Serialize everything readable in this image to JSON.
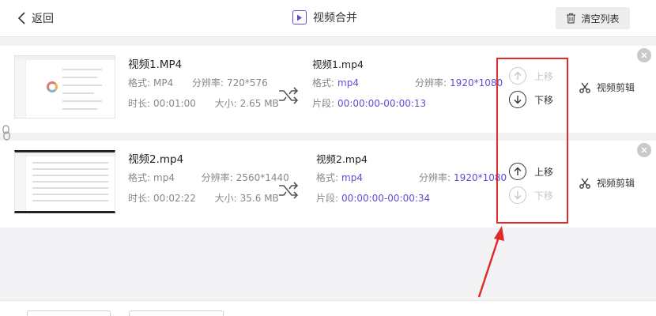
{
  "header": {
    "back_label": "返回",
    "title": "视频合并",
    "clear_label": "清空列表"
  },
  "items": [
    {
      "src_name": "视频1.MP4",
      "format_label": "格式:",
      "format": "MP4",
      "resolution_label": "分辨率:",
      "resolution": "720*576",
      "duration_label": "时长:",
      "duration": "00:01:00",
      "size_label": "大小:",
      "size": "2.65 MB",
      "dst_name": "视频1.mp4",
      "dst_format_label": "格式:",
      "dst_format": "mp4",
      "dst_resolution_label": "分辨率:",
      "dst_resolution": "1920*1080",
      "segment_label": "片段:",
      "segment": "00:00:00-00:00:13",
      "move_up": "上移",
      "move_down": "下移",
      "edit_label": "视频剪辑"
    },
    {
      "src_name": "视频2.mp4",
      "format_label": "格式:",
      "format": "mp4",
      "resolution_label": "分辨率:",
      "resolution": "2560*1440",
      "duration_label": "时长:",
      "duration": "00:02:22",
      "size_label": "大小:",
      "size": "35.6 MB",
      "dst_name": "视频2.mp4",
      "dst_format_label": "格式:",
      "dst_format": "mp4",
      "dst_resolution_label": "分辨率:",
      "dst_resolution": "1920*1080",
      "segment_label": "片段:",
      "segment": "00:00:00-00:00:34",
      "move_up": "上移",
      "move_down": "下移",
      "edit_label": "视频剪辑"
    }
  ],
  "colors": {
    "accent": "#5b4fd6",
    "annotation": "#e02b2b",
    "disabled": "#c8c8c8"
  }
}
